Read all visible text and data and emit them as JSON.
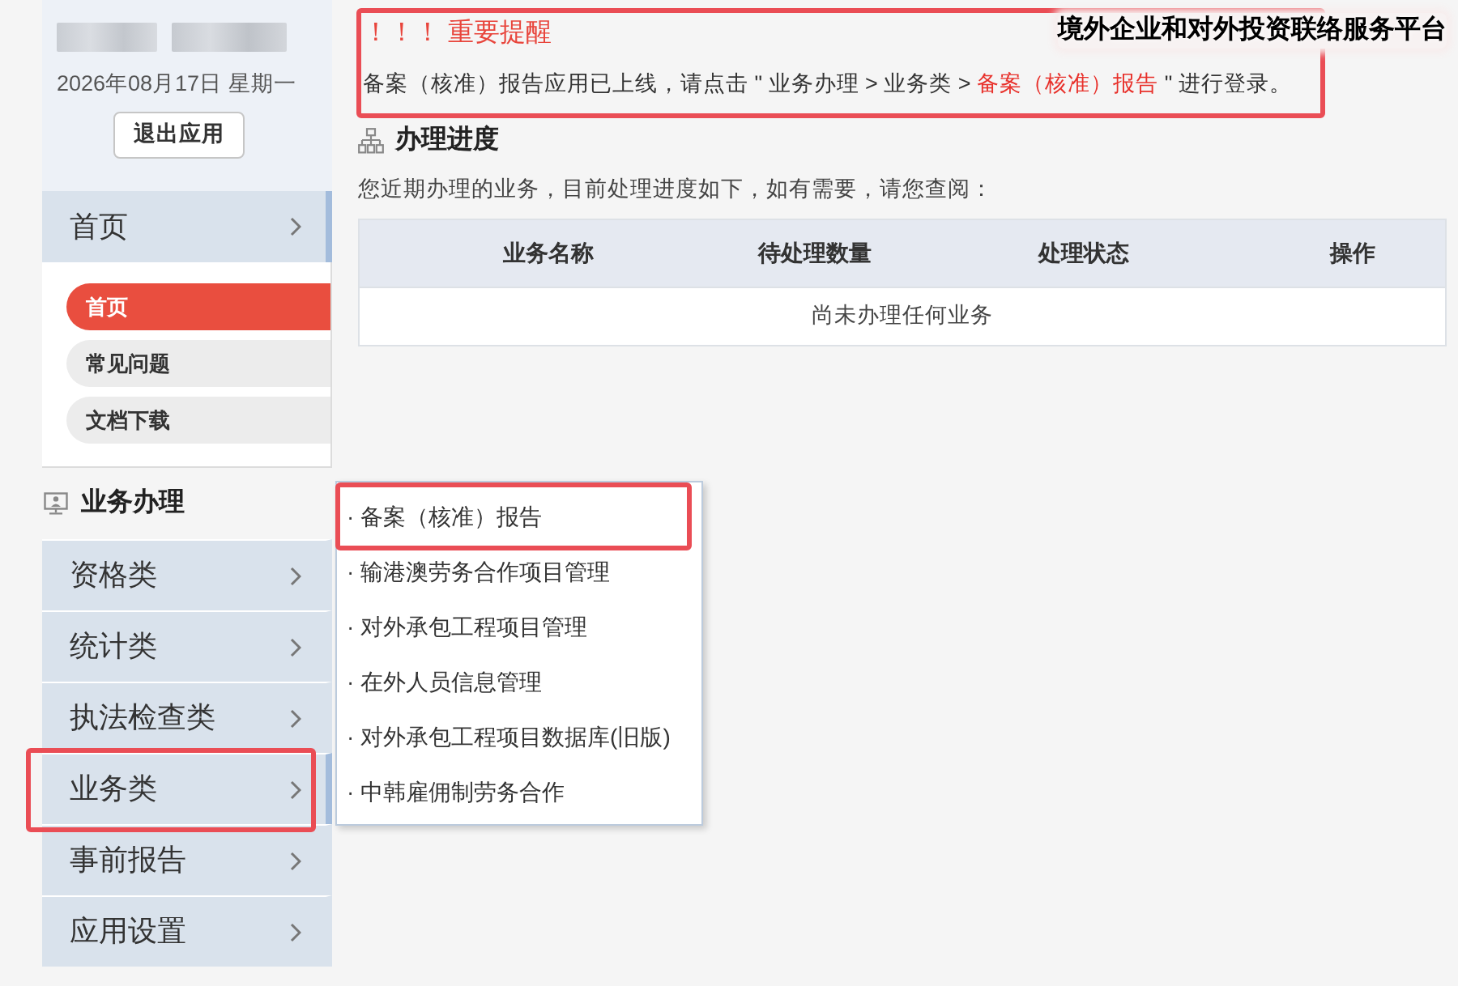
{
  "platform_title": "境外企业和对外投资联络服务平台",
  "user_panel": {
    "date": "2026年08月17日 星期一",
    "logout_button": "退出应用"
  },
  "home_menu": {
    "label": "首页",
    "selected": true,
    "submenu": [
      {
        "label": "首页",
        "selected": true
      },
      {
        "label": "常见问题",
        "selected": false
      },
      {
        "label": "文档下载",
        "selected": false
      }
    ]
  },
  "business_section": {
    "title": "业务办理",
    "items": [
      {
        "label": "资格类",
        "selected": false,
        "highlighted": false
      },
      {
        "label": "统计类",
        "selected": false,
        "highlighted": false
      },
      {
        "label": "执法检查类",
        "selected": false,
        "highlighted": false
      },
      {
        "label": "业务类",
        "selected": true,
        "highlighted": true
      },
      {
        "label": "事前报告",
        "selected": false,
        "highlighted": false
      },
      {
        "label": "应用设置",
        "selected": false,
        "highlighted": false
      }
    ]
  },
  "dropdown_menu": {
    "items": [
      {
        "label": "· 备案（核准）报告",
        "highlighted": true
      },
      {
        "label": "· 输港澳劳务合作项目管理",
        "highlighted": false
      },
      {
        "label": "· 对外承包工程项目管理",
        "highlighted": false
      },
      {
        "label": "· 在外人员信息管理",
        "highlighted": false
      },
      {
        "label": "· 对外承包工程项目数据库(旧版)",
        "highlighted": false
      },
      {
        "label": "· 中韩雇佣制劳务合作",
        "highlighted": false
      }
    ]
  },
  "notice": {
    "highlighted": true,
    "title": "！！！ 重要提醒",
    "message": [
      {
        "text": "备案（核准）报告应用已上线，请点击 \" 业务办理 > 业务类 > ",
        "kind": "plain"
      },
      {
        "text": "备案（核准）报告",
        "kind": "emphasis"
      },
      {
        "text": " \" 进行登录。",
        "kind": "plain"
      }
    ]
  },
  "progress_section": {
    "title": "办理进度",
    "description": "您近期办理的业务，目前处理进度如下，如有需要，请您查阅：",
    "table": {
      "columns": [
        "业务名称",
        "待处理数量",
        "处理状态",
        "操作"
      ],
      "empty_message": "尚未办理任何业务"
    }
  }
}
